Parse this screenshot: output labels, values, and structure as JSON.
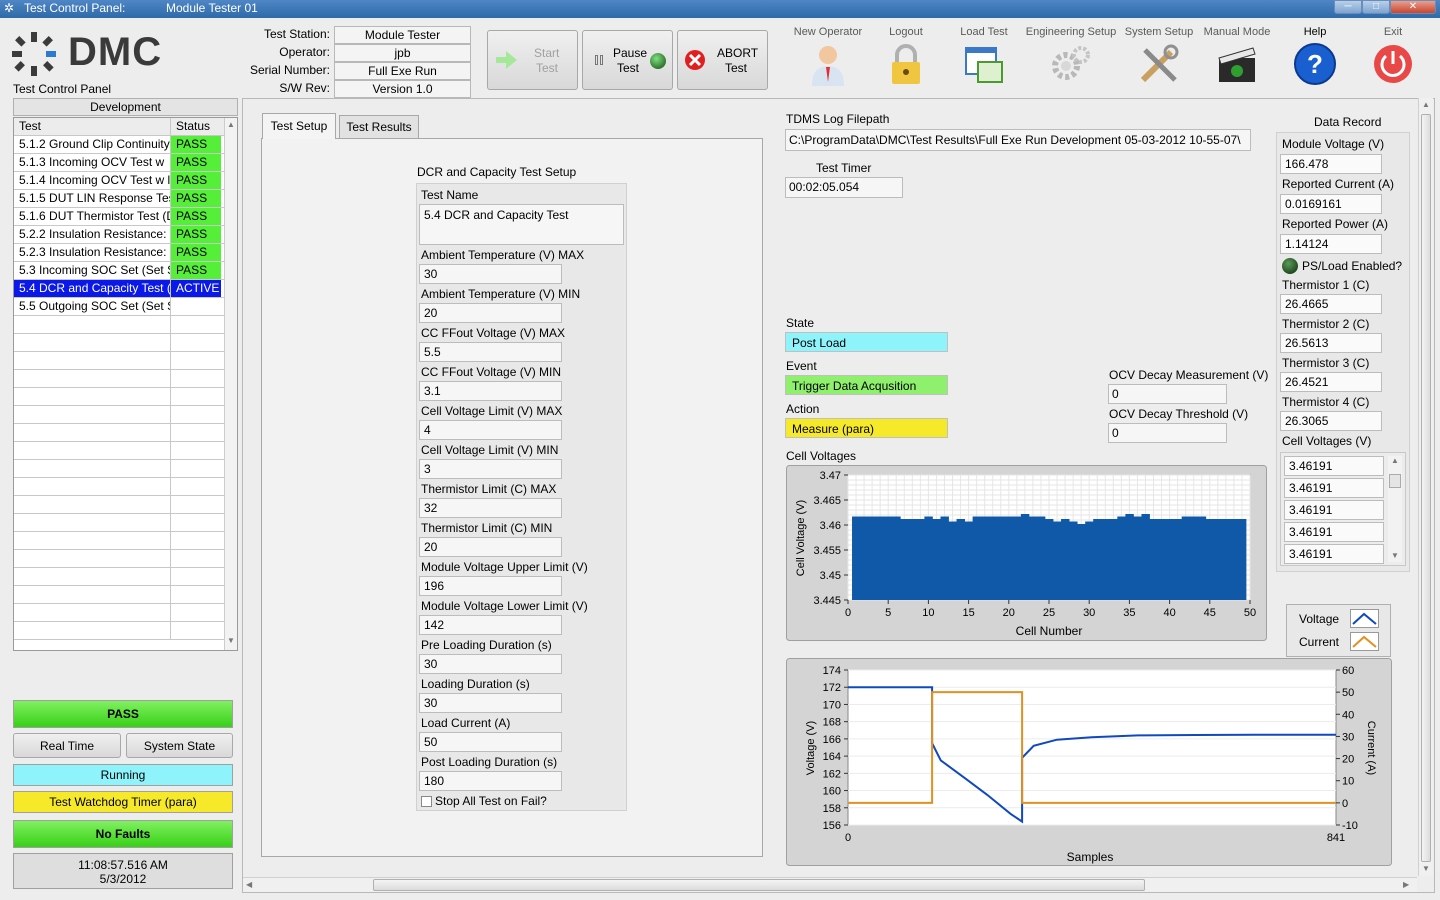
{
  "window": {
    "title_left": "Test Control Panel:",
    "title_right": "Module Tester 01",
    "btn_min": "─",
    "btn_max": "□",
    "btn_close": "✕"
  },
  "logo": {
    "text": "DMC",
    "caption": "Test Control Panel"
  },
  "station": {
    "labels": [
      "Test Station:",
      "Operator:",
      "Serial Number:",
      "S/W Rev:"
    ],
    "values": [
      "Module Tester",
      "jpb",
      "Full Exe Run",
      "Version 1.0"
    ]
  },
  "controls": {
    "start_line1": "Start",
    "start_line2": "Test",
    "pause_line1": "Pause",
    "pause_line2": "Test",
    "abort_line1": "ABORT",
    "abort_line2": "Test"
  },
  "toolbar": [
    {
      "label": "New Operator",
      "icon": "user-icon"
    },
    {
      "label": "Logout",
      "icon": "lock-icon"
    },
    {
      "label": "Load Test",
      "icon": "windows-icon"
    },
    {
      "label": "Engineering Setup",
      "icon": "gears-icon"
    },
    {
      "label": "System Setup",
      "icon": "tools-icon"
    },
    {
      "label": "Manual Mode",
      "icon": "clapperboard-icon"
    },
    {
      "label": "Help",
      "icon": "help-icon"
    },
    {
      "label": "Exit",
      "icon": "power-icon"
    }
  ],
  "tests": {
    "group": "Development",
    "header_test": "Test",
    "header_status": "Status",
    "rows": [
      {
        "name": "5.1.2 Ground Clip Continuity",
        "status": "PASS"
      },
      {
        "name": "5.1.3 Incoming OCV Test  w",
        "status": "PASS"
      },
      {
        "name": "5.1.4 Incoming OCV Test w l",
        "status": "PASS"
      },
      {
        "name": "5.1.5 DUT LIN Response Test",
        "status": "PASS"
      },
      {
        "name": "5.1.6 DUT Thermistor Test (D",
        "status": "PASS"
      },
      {
        "name": "5.2.2 Insulation Resistance: C",
        "status": "PASS"
      },
      {
        "name": "5.2.3 Insulation Resistance: C",
        "status": "PASS"
      },
      {
        "name": "5.3 Incoming SOC Set (Set SO",
        "status": "PASS"
      },
      {
        "name": "5.4 DCR and Capacity Test (l",
        "status": "ACTIVE"
      },
      {
        "name": "5.5 Outgoing SOC Set (Set SO",
        "status": ""
      }
    ]
  },
  "status": {
    "result": "PASS",
    "btn_realtime": "Real Time",
    "btn_systemstate": "System State",
    "running": "Running",
    "watchdog": "Test Watchdog Timer (para)",
    "faults": "No Faults",
    "time": "11:08:57.516 AM",
    "date": "5/3/2012"
  },
  "tabs": {
    "setup": "Test Setup",
    "results": "Test Results"
  },
  "setup": {
    "heading": "DCR and Capacity Test Setup",
    "test_name_label": "Test Name",
    "test_name": "5.4 DCR and Capacity Test",
    "fields": [
      {
        "label": "Ambient Temperature (V) MAX",
        "value": "30"
      },
      {
        "label": "Ambient Temperature (V) MIN",
        "value": "20"
      },
      {
        "label": "CC FFout Voltage (V) MAX",
        "value": "5.5"
      },
      {
        "label": "CC FFout Voltage (V) MIN",
        "value": "3.1"
      },
      {
        "label": "Cell Voltage Limit (V) MAX",
        "value": "4"
      },
      {
        "label": "Cell Voltage Limit (V) MIN",
        "value": "3"
      },
      {
        "label": "Thermistor Limit (C) MAX",
        "value": "32"
      },
      {
        "label": "Thermistor Limit (C) MIN",
        "value": "20"
      },
      {
        "label": "Module Voltage Upper Limit (V)",
        "value": "196"
      },
      {
        "label": "Module Voltage Lower Limit (V)",
        "value": "142"
      },
      {
        "label": "Pre Loading Duration (s)",
        "value": "30"
      },
      {
        "label": "Loading Duration (s)",
        "value": "30"
      },
      {
        "label": "Load Current (A)",
        "value": "50"
      },
      {
        "label": "Post Loading Duration (s)",
        "value": "180"
      }
    ],
    "stop_all": "Stop All Test on Fail?"
  },
  "log": {
    "label": "TDMS Log Filepath",
    "path": "C:\\ProgramData\\DMC\\Test Results\\Full Exe Run   Development 05-03-2012 10-55-07\\",
    "timer_label": "Test Timer",
    "timer": "00:02:05.054"
  },
  "state": {
    "state_label": "State",
    "state": "Post Load",
    "event_label": "Event",
    "event": "Trigger Data Acqusition",
    "action_label": "Action",
    "action": "Measure (para)",
    "ocv_meas_label": "OCV Decay Measurement (V)",
    "ocv_meas": "0",
    "ocv_thr_label": "OCV Decay Threshold (V)",
    "ocv_thr": "0"
  },
  "record": {
    "title": "Data Record",
    "items": [
      {
        "label": "Module Voltage (V)",
        "value": "166.478"
      },
      {
        "label": "Reported Current (A)",
        "value": "0.0169161"
      },
      {
        "label": "Reported Power (A)",
        "value": "1.14124"
      }
    ],
    "ps_load": "PS/Load Enabled?",
    "thermistors": [
      {
        "label": "Thermistor 1 (C)",
        "value": "26.4665"
      },
      {
        "label": "Thermistor 2 (C)",
        "value": "26.5613"
      },
      {
        "label": "Thermistor 3 (C)",
        "value": "26.4521"
      },
      {
        "label": "Thermistor 4 (C)",
        "value": "26.3065"
      }
    ],
    "cell_label": "Cell Voltages (V)",
    "cells": [
      "3.46191",
      "3.46191",
      "3.46191",
      "3.46191",
      "3.46191"
    ]
  },
  "legend": {
    "voltage": "Voltage",
    "current": "Current"
  },
  "colors": {
    "pass": "#55ee39",
    "active": "#0a18e8",
    "state": "#8ff3fb",
    "event": "#8ff06e",
    "action": "#f5e92a",
    "bar": "#1058a8",
    "voltage": "#1048c0",
    "current": "#e29020"
  },
  "chart_data": [
    {
      "type": "bar",
      "title": "Cell Voltages",
      "xlabel": "Cell Number",
      "ylabel": "Cell Voltage (V)",
      "ylim": [
        3.445,
        3.47
      ],
      "xlim": [
        0,
        50
      ],
      "xticks": [
        0,
        5,
        10,
        15,
        20,
        25,
        30,
        35,
        40,
        45,
        50
      ],
      "yticks": [
        "3.445",
        "3.45",
        "3.455",
        "3.46",
        "3.465",
        "3.47"
      ],
      "x": [
        1,
        2,
        3,
        4,
        5,
        6,
        7,
        8,
        9,
        10,
        11,
        12,
        13,
        14,
        15,
        16,
        17,
        18,
        19,
        20,
        21,
        22,
        23,
        24,
        25,
        26,
        27,
        28,
        29,
        30,
        31,
        32,
        33,
        34,
        35,
        36,
        37,
        38,
        39,
        40,
        41,
        42,
        43,
        44,
        45,
        46,
        47,
        48,
        49
      ],
      "values": [
        3.4617,
        3.4617,
        3.4617,
        3.4617,
        3.4617,
        3.4617,
        3.4612,
        3.4612,
        3.4612,
        3.4617,
        3.4612,
        3.4617,
        3.4607,
        3.4612,
        3.4607,
        3.4617,
        3.4617,
        3.4617,
        3.4617,
        3.4617,
        3.4617,
        3.4622,
        3.4617,
        3.4617,
        3.4612,
        3.4607,
        3.4612,
        3.4607,
        3.4602,
        3.4607,
        3.4612,
        3.4612,
        3.4612,
        3.4617,
        3.4622,
        3.4617,
        3.4622,
        3.4612,
        3.4612,
        3.4612,
        3.4612,
        3.4617,
        3.4617,
        3.4617,
        3.4612,
        3.4612,
        3.4612,
        3.4612,
        3.4612
      ]
    },
    {
      "type": "line",
      "xlabel": "Samples",
      "ylabel": "Voltage (V)",
      "y2label": "Current (A)",
      "xlim": [
        0,
        841
      ],
      "ylim": [
        156,
        174
      ],
      "y2lim": [
        -10,
        60
      ],
      "xticks": [
        "0",
        "841"
      ],
      "yticks": [
        "156",
        "158",
        "160",
        "162",
        "164",
        "166",
        "168",
        "170",
        "172",
        "174"
      ],
      "y2ticks": [
        "-10",
        "0",
        "10",
        "20",
        "30",
        "40",
        "50",
        "60"
      ],
      "series": [
        {
          "name": "Voltage",
          "axis": "left",
          "x": [
            0,
            145,
            145,
            160,
            200,
            240,
            280,
            300,
            300,
            320,
            360,
            420,
            500,
            600,
            700,
            841
          ],
          "values": [
            172,
            172,
            165.5,
            163.5,
            161.5,
            159.5,
            157.3,
            156.4,
            163.8,
            165.2,
            165.9,
            166.2,
            166.4,
            166.45,
            166.48,
            166.48
          ]
        },
        {
          "name": "Current",
          "axis": "right",
          "x": [
            0,
            145,
            145,
            300,
            300,
            841
          ],
          "values": [
            0,
            0,
            50,
            50,
            0,
            0
          ]
        }
      ]
    }
  ]
}
